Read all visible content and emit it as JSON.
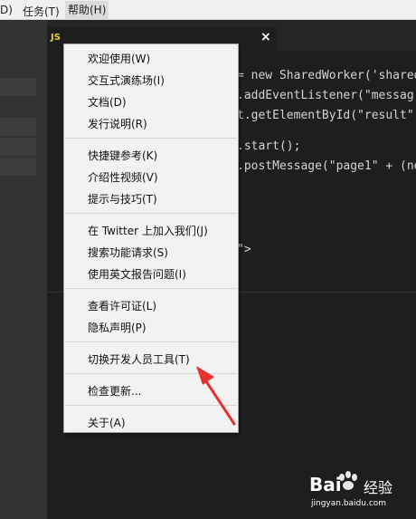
{
  "menubar": {
    "items": [
      {
        "label": "D)"
      },
      {
        "label": "任务(T)"
      },
      {
        "label": "帮助(H)"
      }
    ]
  },
  "tab": {
    "lang_badge": "JS",
    "close_glyph": "×"
  },
  "code_lines": [
    {
      "text": "= new SharedWorker('shared"
    },
    {
      "text": ".addEventListener(\"messag"
    },
    {
      "text": "t.getElementById(\"result\""
    },
    {
      "text": ".start();"
    },
    {
      "text": ".postMessage(\"page1\" + (ne"
    },
    {
      "text": "\">"
    }
  ],
  "help_menu": {
    "groups": [
      [
        "欢迎使用(W)",
        "交互式演练场(I)",
        "文档(D)",
        "发行说明(R)"
      ],
      [
        "快捷键参考(K)",
        "介绍性视频(V)",
        "提示与技巧(T)"
      ],
      [
        "在 Twitter 上加入我们(J)",
        "搜索功能请求(S)",
        "使用英文报告问题(I)"
      ],
      [
        "查看许可证(L)",
        "隐私声明(P)"
      ],
      [
        "切换开发人员工具(T)"
      ],
      [
        "检查更新..."
      ],
      [
        "关于(A)"
      ]
    ]
  },
  "watermark": {
    "brand": "Bai",
    "brand_cn": "经验",
    "url": "jingyan.baidu.com"
  },
  "colors": {
    "annotation_arrow": "#e8322f",
    "editor_bg": "#1e1e1e",
    "menu_bg": "#f2f2f2"
  }
}
